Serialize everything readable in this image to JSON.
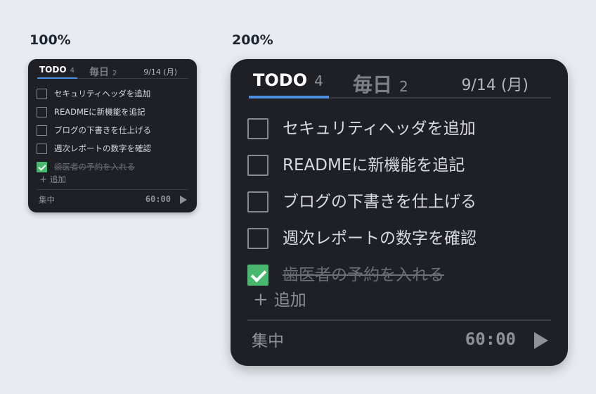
{
  "labels": {
    "scale_1x": "100%",
    "scale_2x": "200%"
  },
  "widget": {
    "tabs": [
      {
        "label": "TODO",
        "count": "4",
        "active": true
      },
      {
        "label": "毎日",
        "count": "2",
        "active": false
      }
    ],
    "date": "9/14 (月)",
    "items": [
      {
        "text": "セキュリティヘッダを追加",
        "done": false
      },
      {
        "text": "READMEに新機能を追記",
        "done": false
      },
      {
        "text": "ブログの下書きを仕上げる",
        "done": false
      },
      {
        "text": "週次レポートの数字を確認",
        "done": false
      },
      {
        "text": "歯医者の予約を入れる",
        "done": true
      }
    ],
    "add_label": "追加",
    "add_icon": "plus-icon",
    "focus_label": "集中",
    "timer": "60:00",
    "play_icon": "play-icon",
    "colors": {
      "accent": "#4f8fe0",
      "check": "#47b86e",
      "background": "#1f2026"
    }
  }
}
